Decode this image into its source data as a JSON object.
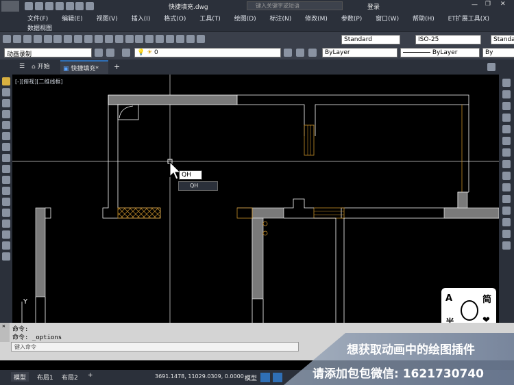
{
  "titlebar": {
    "file_name": "快捷填充.dwg",
    "search_placeholder": "键入关键字或短语",
    "login": "登录"
  },
  "menu": [
    "文件(F)",
    "编辑(E)",
    "视图(V)",
    "插入(I)",
    "格式(O)",
    "工具(T)",
    "绘图(D)",
    "标注(N)",
    "修改(M)",
    "参数(P)",
    "窗口(W)",
    "帮助(H)",
    "ET扩展工具(X)"
  ],
  "menu_row2": "数据视图",
  "toolbar": {
    "text_style": "Standard",
    "dim_style": "ISO-25",
    "table_style": "Standa"
  },
  "toolbar2": {
    "workspace": "动画录制",
    "layer": "0",
    "color": "ByLayer",
    "linetype": "ByLayer",
    "lineweight": "By"
  },
  "tabs": {
    "start": "开始",
    "active": "快捷填充*",
    "add": "+"
  },
  "viewport_label": "[-][俯视][二维线框]",
  "input": {
    "value": "QH",
    "suggestion": "QH"
  },
  "command": {
    "line1": "命令:",
    "line2": "命令: _options",
    "prompt": "键入命令"
  },
  "status": {
    "coords": "3691.1478, 11029.0309, 0.0000",
    "model": "模型"
  },
  "layout_tabs": [
    "模型",
    "布局1",
    "布局2"
  ],
  "watermark": {
    "line1": "想获取动画中的绘图插件",
    "line2": "请添加包包微信: 1621730740"
  },
  "sticker": {
    "left_top": "A",
    "left_bottom": "半",
    "right_top": "简",
    "right_bottom": "❤"
  },
  "colors": {
    "bg": "#000000",
    "ui_dark": "#2b303a",
    "wall_gray": "#7a7a7a",
    "orange": "#c8902a",
    "accent_blue": "#2f6fb5"
  }
}
